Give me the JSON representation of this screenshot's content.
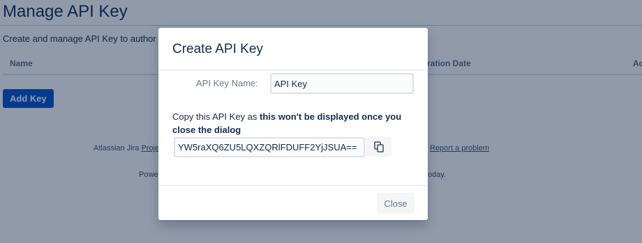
{
  "page": {
    "title": "Manage API Key",
    "description": "Create and manage API Key to author"
  },
  "table": {
    "columns": [
      "Name",
      "ration Date",
      "Ac"
    ]
  },
  "actions": {
    "add_key_label": "Add Key"
  },
  "footer": {
    "line1_left": "Atlassian Jira ",
    "line1_link": "Proje",
    "line1_right_link": "Report a problem",
    "line2_left": "Powe",
    "line2_right": "oday."
  },
  "dialog": {
    "title": "Create API Key",
    "name_label": "API Key Name:",
    "name_value": "API Key",
    "copy_note_plain": "Copy this API Key as ",
    "copy_note_bold": "this won't be displayed once you close the dialog",
    "api_key_value": "YW5raXQ6ZU5LQXZQRlFDUFF2YjJSUA==",
    "copy_icon": "copy-icon",
    "close_label": "Close"
  },
  "colors": {
    "primary": "#0052cc",
    "overlay": "#091e42",
    "text": "#172b4d"
  }
}
